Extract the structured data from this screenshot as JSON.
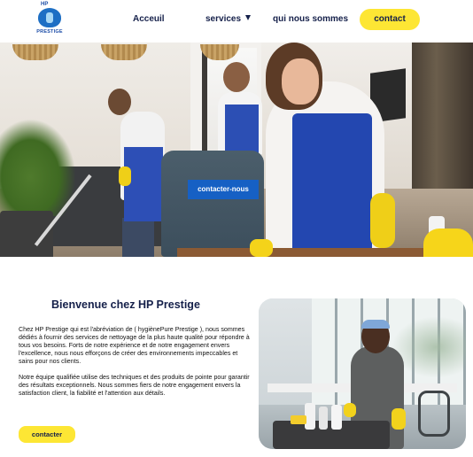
{
  "header": {
    "logo": {
      "top_text": "HP",
      "bottom_text": "PRESTIGE"
    },
    "nav": {
      "accueil": "Acceuil",
      "services": "services",
      "about": "qui nous sommes",
      "contact": "contact"
    }
  },
  "hero": {
    "cta_label": "contacter-nous"
  },
  "welcome": {
    "title": "Bienvenue chez HP Prestige",
    "paragraph1": "Chez HP Prestige qui est l'abréviation de ( hygiènePure Prestige ), nous sommes dédiés à fournir des services de nettoyage de la plus haute qualité pour répondre à tous vos besoins. Forts de notre expérience et de notre engagement envers l'excellence, nous nous efforçons de créer des environnements impeccables et sains pour nos clients.",
    "paragraph2": "Notre équipe qualifiée utilise des techniques et des produits de pointe pour garantir des résultats exceptionnels. Nous sommes fiers de notre engagement envers la satisfaction client, la fiabilité et l'attention aux détails.",
    "cta_label": "contacter"
  },
  "colors": {
    "accent_yellow": "#fde634",
    "accent_blue": "#1660c4",
    "text_dark": "#15204a"
  }
}
